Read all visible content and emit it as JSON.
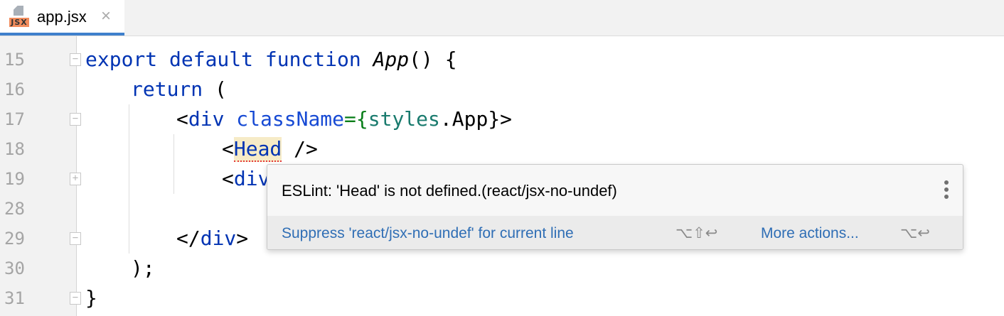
{
  "tab": {
    "badge": "JSX",
    "name": "app.jsx"
  },
  "lines": [
    {
      "n": "15"
    },
    {
      "n": "16"
    },
    {
      "n": "17"
    },
    {
      "n": "18"
    },
    {
      "n": "19"
    },
    {
      "n": "28"
    },
    {
      "n": "29"
    },
    {
      "n": "30"
    },
    {
      "n": "31"
    }
  ],
  "code": {
    "l15": {
      "a": "export default function ",
      "b": "App",
      "c": "() {"
    },
    "l16": {
      "a": "return",
      "b": " ("
    },
    "l17": {
      "a": "<",
      "b": "div",
      "c": " ",
      "d": "className",
      "e": "=",
      "f": "{",
      "g": "styles",
      "h": ".App}>"
    },
    "l18": {
      "a": "<",
      "b": "Head",
      "c": " />"
    },
    "l19": {
      "a": "<",
      "b": "div"
    },
    "l29": {
      "a": "</",
      "b": "div",
      "c": ">"
    },
    "l30": {
      "a": ");"
    },
    "l31": {
      "a": "}"
    }
  },
  "popup": {
    "message": "ESLint: 'Head' is not defined.(react/jsx-no-undef)",
    "suppress": "Suppress 'react/jsx-no-undef' for current line",
    "suppress_shortcut": "⌥⇧↩",
    "more": "More actions...",
    "more_shortcut": "⌥↩"
  }
}
